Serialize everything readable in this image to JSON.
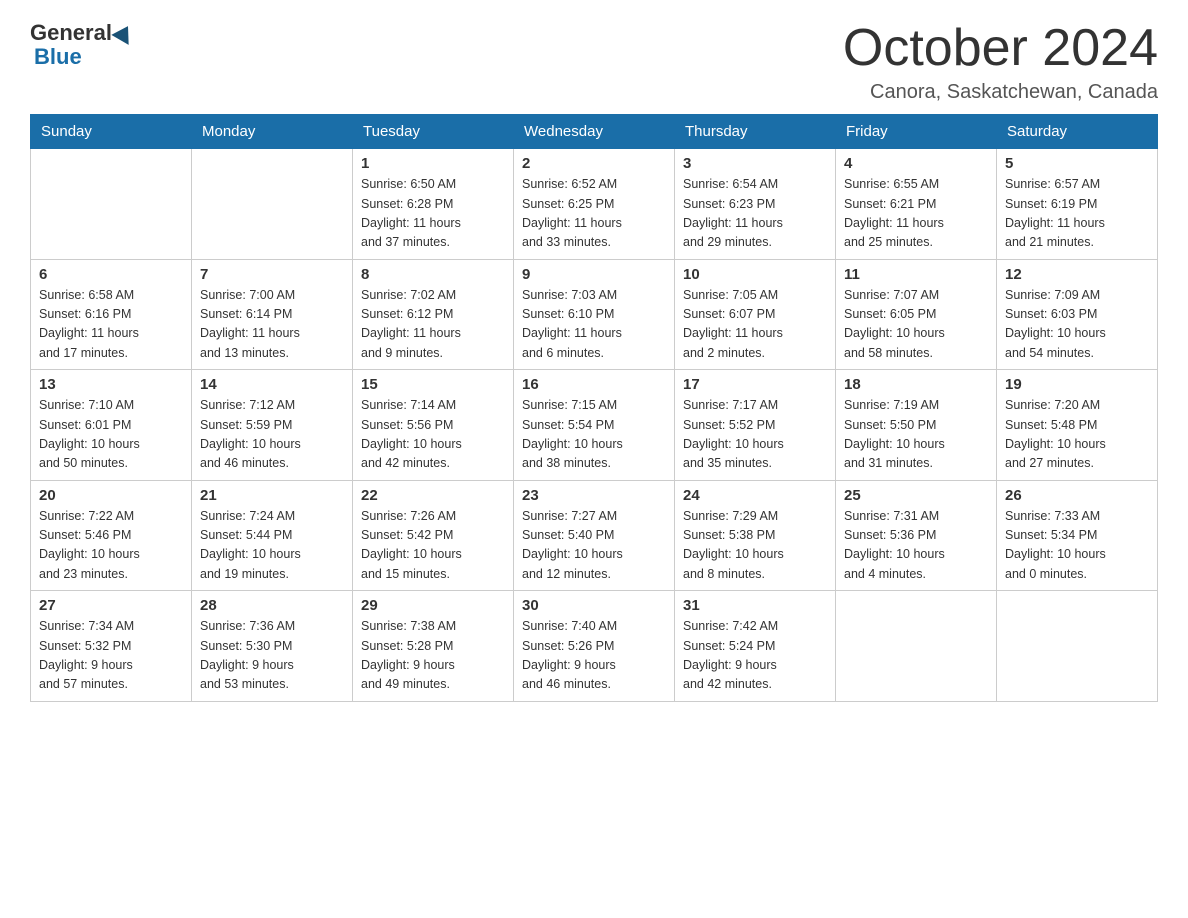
{
  "header": {
    "logo_general": "General",
    "logo_blue": "Blue",
    "month_title": "October 2024",
    "location": "Canora, Saskatchewan, Canada"
  },
  "days_of_week": [
    "Sunday",
    "Monday",
    "Tuesday",
    "Wednesday",
    "Thursday",
    "Friday",
    "Saturday"
  ],
  "weeks": [
    [
      {
        "day": "",
        "info": ""
      },
      {
        "day": "",
        "info": ""
      },
      {
        "day": "1",
        "info": "Sunrise: 6:50 AM\nSunset: 6:28 PM\nDaylight: 11 hours\nand 37 minutes."
      },
      {
        "day": "2",
        "info": "Sunrise: 6:52 AM\nSunset: 6:25 PM\nDaylight: 11 hours\nand 33 minutes."
      },
      {
        "day": "3",
        "info": "Sunrise: 6:54 AM\nSunset: 6:23 PM\nDaylight: 11 hours\nand 29 minutes."
      },
      {
        "day": "4",
        "info": "Sunrise: 6:55 AM\nSunset: 6:21 PM\nDaylight: 11 hours\nand 25 minutes."
      },
      {
        "day": "5",
        "info": "Sunrise: 6:57 AM\nSunset: 6:19 PM\nDaylight: 11 hours\nand 21 minutes."
      }
    ],
    [
      {
        "day": "6",
        "info": "Sunrise: 6:58 AM\nSunset: 6:16 PM\nDaylight: 11 hours\nand 17 minutes."
      },
      {
        "day": "7",
        "info": "Sunrise: 7:00 AM\nSunset: 6:14 PM\nDaylight: 11 hours\nand 13 minutes."
      },
      {
        "day": "8",
        "info": "Sunrise: 7:02 AM\nSunset: 6:12 PM\nDaylight: 11 hours\nand 9 minutes."
      },
      {
        "day": "9",
        "info": "Sunrise: 7:03 AM\nSunset: 6:10 PM\nDaylight: 11 hours\nand 6 minutes."
      },
      {
        "day": "10",
        "info": "Sunrise: 7:05 AM\nSunset: 6:07 PM\nDaylight: 11 hours\nand 2 minutes."
      },
      {
        "day": "11",
        "info": "Sunrise: 7:07 AM\nSunset: 6:05 PM\nDaylight: 10 hours\nand 58 minutes."
      },
      {
        "day": "12",
        "info": "Sunrise: 7:09 AM\nSunset: 6:03 PM\nDaylight: 10 hours\nand 54 minutes."
      }
    ],
    [
      {
        "day": "13",
        "info": "Sunrise: 7:10 AM\nSunset: 6:01 PM\nDaylight: 10 hours\nand 50 minutes."
      },
      {
        "day": "14",
        "info": "Sunrise: 7:12 AM\nSunset: 5:59 PM\nDaylight: 10 hours\nand 46 minutes."
      },
      {
        "day": "15",
        "info": "Sunrise: 7:14 AM\nSunset: 5:56 PM\nDaylight: 10 hours\nand 42 minutes."
      },
      {
        "day": "16",
        "info": "Sunrise: 7:15 AM\nSunset: 5:54 PM\nDaylight: 10 hours\nand 38 minutes."
      },
      {
        "day": "17",
        "info": "Sunrise: 7:17 AM\nSunset: 5:52 PM\nDaylight: 10 hours\nand 35 minutes."
      },
      {
        "day": "18",
        "info": "Sunrise: 7:19 AM\nSunset: 5:50 PM\nDaylight: 10 hours\nand 31 minutes."
      },
      {
        "day": "19",
        "info": "Sunrise: 7:20 AM\nSunset: 5:48 PM\nDaylight: 10 hours\nand 27 minutes."
      }
    ],
    [
      {
        "day": "20",
        "info": "Sunrise: 7:22 AM\nSunset: 5:46 PM\nDaylight: 10 hours\nand 23 minutes."
      },
      {
        "day": "21",
        "info": "Sunrise: 7:24 AM\nSunset: 5:44 PM\nDaylight: 10 hours\nand 19 minutes."
      },
      {
        "day": "22",
        "info": "Sunrise: 7:26 AM\nSunset: 5:42 PM\nDaylight: 10 hours\nand 15 minutes."
      },
      {
        "day": "23",
        "info": "Sunrise: 7:27 AM\nSunset: 5:40 PM\nDaylight: 10 hours\nand 12 minutes."
      },
      {
        "day": "24",
        "info": "Sunrise: 7:29 AM\nSunset: 5:38 PM\nDaylight: 10 hours\nand 8 minutes."
      },
      {
        "day": "25",
        "info": "Sunrise: 7:31 AM\nSunset: 5:36 PM\nDaylight: 10 hours\nand 4 minutes."
      },
      {
        "day": "26",
        "info": "Sunrise: 7:33 AM\nSunset: 5:34 PM\nDaylight: 10 hours\nand 0 minutes."
      }
    ],
    [
      {
        "day": "27",
        "info": "Sunrise: 7:34 AM\nSunset: 5:32 PM\nDaylight: 9 hours\nand 57 minutes."
      },
      {
        "day": "28",
        "info": "Sunrise: 7:36 AM\nSunset: 5:30 PM\nDaylight: 9 hours\nand 53 minutes."
      },
      {
        "day": "29",
        "info": "Sunrise: 7:38 AM\nSunset: 5:28 PM\nDaylight: 9 hours\nand 49 minutes."
      },
      {
        "day": "30",
        "info": "Sunrise: 7:40 AM\nSunset: 5:26 PM\nDaylight: 9 hours\nand 46 minutes."
      },
      {
        "day": "31",
        "info": "Sunrise: 7:42 AM\nSunset: 5:24 PM\nDaylight: 9 hours\nand 42 minutes."
      },
      {
        "day": "",
        "info": ""
      },
      {
        "day": "",
        "info": ""
      }
    ]
  ]
}
